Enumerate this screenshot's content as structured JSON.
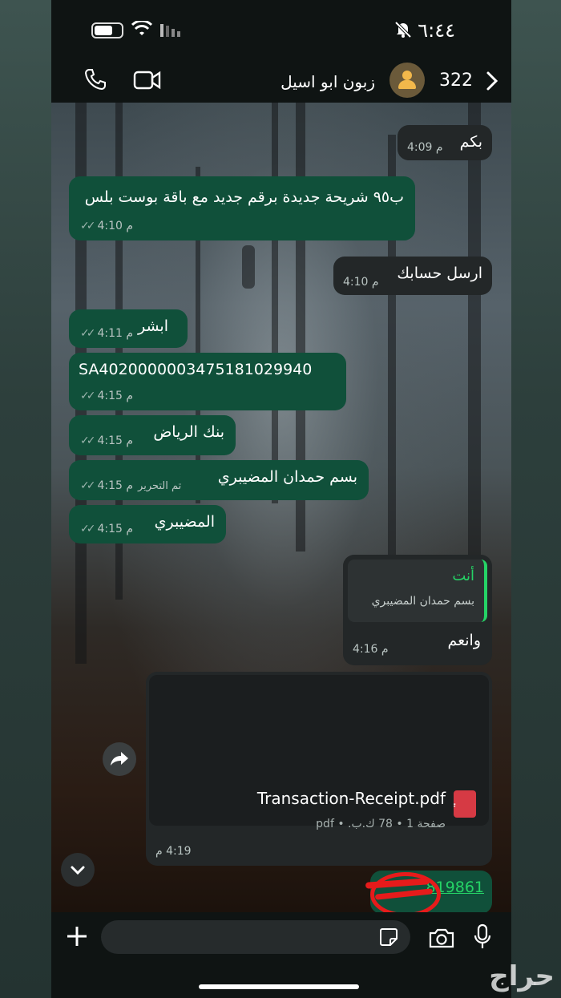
{
  "status_bar": {
    "time": "٦:٤٤"
  },
  "header": {
    "contact_name": "زبون ابو اسيل",
    "back_count": "322"
  },
  "messages": [
    {
      "text": "بكم",
      "time": "4:09 م"
    },
    {
      "text": "ب٩٥ شريحة جديدة برقم جديد مع باقة بوست بلس",
      "time": "4:10 م"
    },
    {
      "text": "ارسل حسابك",
      "time": "4:10 م"
    },
    {
      "text": "ابشر",
      "time": "4:11 م"
    },
    {
      "text": "SA4020000003475181029940",
      "time": "4:15 م"
    },
    {
      "text": "بنك الرياض",
      "time": "4:15 م"
    },
    {
      "text": "بسم حمدان المضيبري",
      "time": "4:15 م",
      "edited": "تم التحرير"
    },
    {
      "text": "المضيبري",
      "time": "4:15 م"
    },
    {
      "reply_author": "أنت",
      "reply_text": "بسم حمدان المضيبري",
      "text": "وانعم",
      "time": "4:16 م"
    },
    {
      "file_name": "Transaction-Receipt.pdf",
      "file_meta": "صفحة 1 • 78 ك.ب. • pdf",
      "time": "4:19 م"
    },
    {
      "text": "819861"
    }
  ],
  "watermark": "حراج",
  "colors": {
    "outgoing": "#10503a",
    "incoming": "#232728",
    "accent": "#25d366"
  }
}
